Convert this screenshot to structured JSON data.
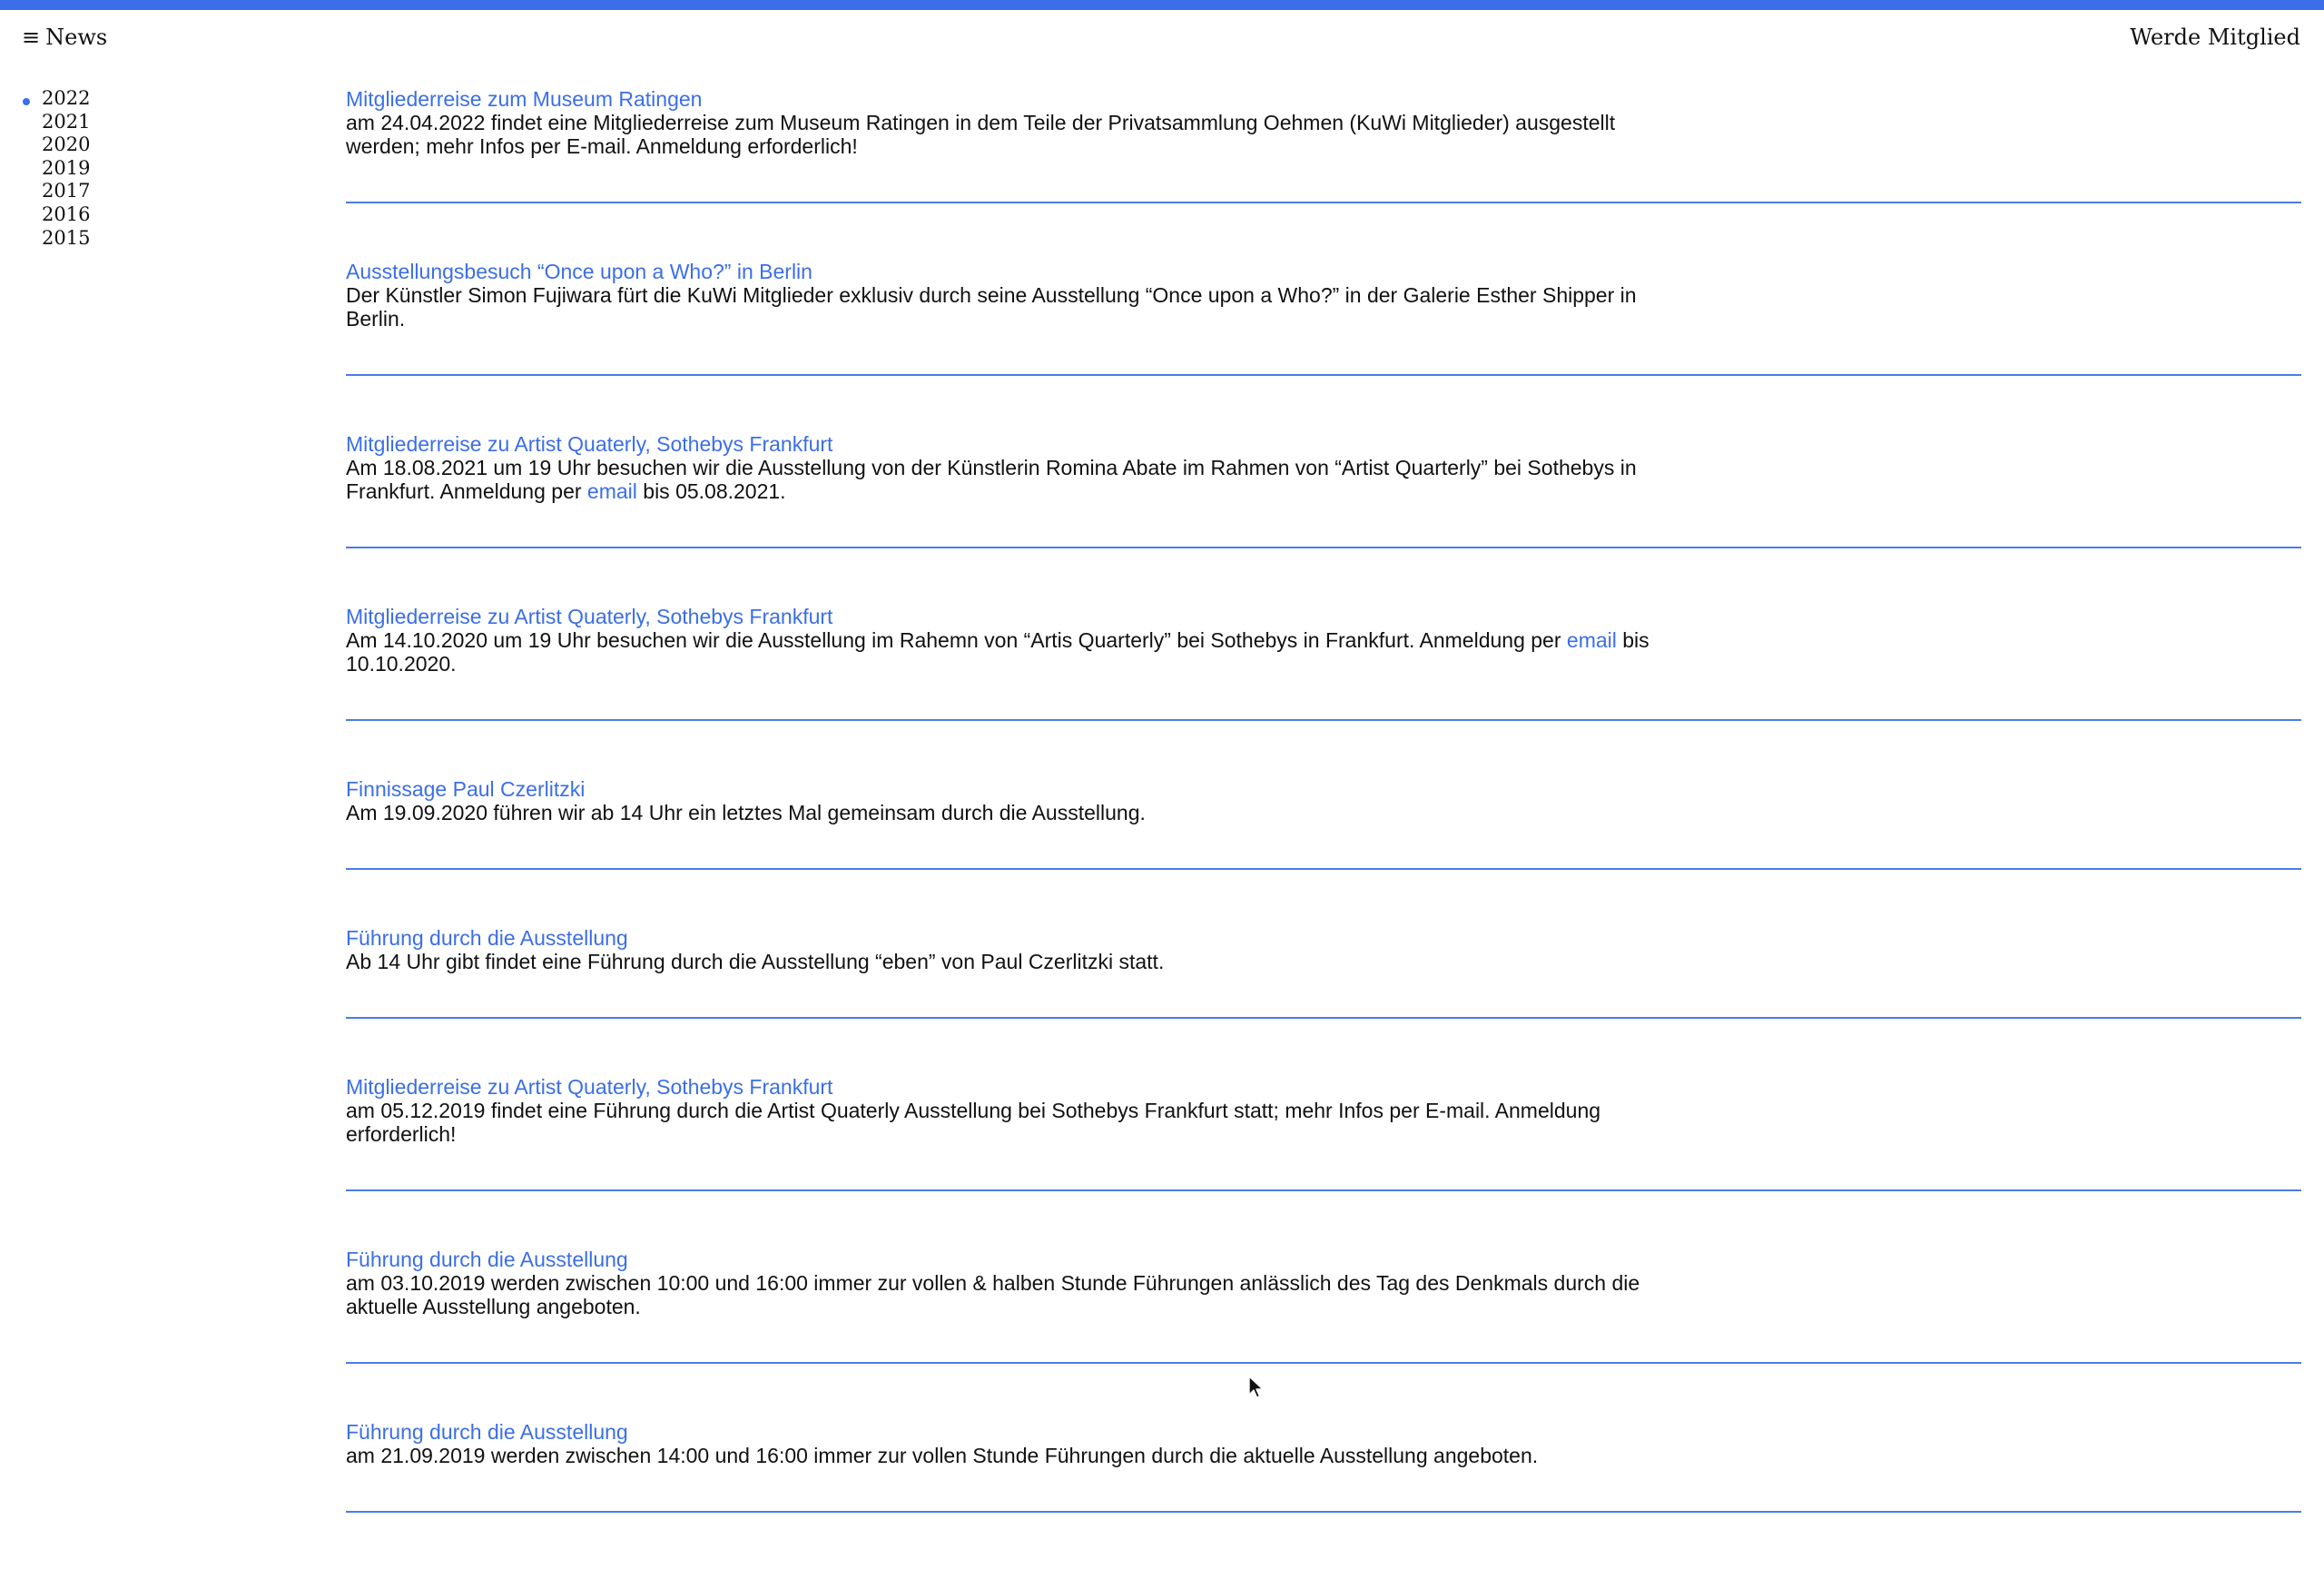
{
  "header": {
    "menu_label": "News",
    "cta_label": "Werde Mitglied"
  },
  "colors": {
    "accent": "#3b6ee8",
    "text": "#111111",
    "background": "#ffffff"
  },
  "years": [
    "2022",
    "2021",
    "2020",
    "2019",
    "2017",
    "2016",
    "2015"
  ],
  "active_year": "2022",
  "news": [
    {
      "title": "Mitgliederreise zum Museum Ratingen",
      "body_before": "am 24.04.2022 findet eine Mitgliederreise zum Museum Ratingen in dem Teile der Privatsammlung Oehmen (KuWi Mitglieder) ausgestellt werden; mehr Infos per E-mail. Anmeldung erforderlich!",
      "link": "",
      "body_after": ""
    },
    {
      "title": "Ausstellungsbesuch “Once upon a Who?” in Berlin",
      "body_before": "Der Künstler Simon Fujiwara fürt die KuWi Mitglieder exklusiv durch seine Ausstellung “Once upon a Who?” in der Galerie Esther Shipper in Berlin.",
      "link": "",
      "body_after": ""
    },
    {
      "title": "Mitgliederreise zu Artist Quaterly, Sothebys Frankfurt",
      "body_before": "Am 18.08.2021 um 19 Uhr besuchen wir die Ausstellung von der Künstlerin Romina Abate im Rahmen von “Artist Quarterly” bei Sothebys in Frankfurt. Anmeldung per ",
      "link": "email",
      "body_after": " bis 05.08.2021."
    },
    {
      "title": "Mitgliederreise zu Artist Quaterly, Sothebys Frankfurt",
      "body_before": "Am 14.10.2020 um 19 Uhr besuchen wir die Ausstellung im Rahemn von “Artis Quarterly” bei Sothebys in Frankfurt. Anmeldung per ",
      "link": "email",
      "body_after": " bis 10.10.2020."
    },
    {
      "title": "Finnissage Paul Czerlitzki",
      "body_before": "Am 19.09.2020 führen wir ab 14 Uhr ein letztes Mal gemeinsam durch die Ausstellung.",
      "link": "",
      "body_after": ""
    },
    {
      "title": "Führung durch die Ausstellung",
      "body_before": "Ab 14 Uhr gibt findet eine Führung durch die Ausstellung “eben” von Paul Czerlitzki statt.",
      "link": "",
      "body_after": ""
    },
    {
      "title": "Mitgliederreise zu Artist Quaterly, Sothebys Frankfurt",
      "body_before": "am 05.12.2019 findet eine Führung durch die Artist Quaterly Ausstellung bei Sothebys Frankfurt statt; mehr Infos per E-mail. Anmeldung erforderlich!",
      "link": "",
      "body_after": ""
    },
    {
      "title": "Führung durch die Ausstellung",
      "body_before": "am 03.10.2019 werden zwischen 10:00 und 16:00 immer zur vollen & halben Stunde Führungen anlässlich des Tag des Denkmals durch die aktuelle Ausstellung angeboten.",
      "link": "",
      "body_after": ""
    },
    {
      "title": "Führung durch die Ausstellung",
      "body_before": "am 21.09.2019 werden zwischen 14:00 und 16:00 immer zur vollen Stunde Führungen durch die aktuelle Ausstellung angeboten.",
      "link": "",
      "body_after": ""
    }
  ]
}
